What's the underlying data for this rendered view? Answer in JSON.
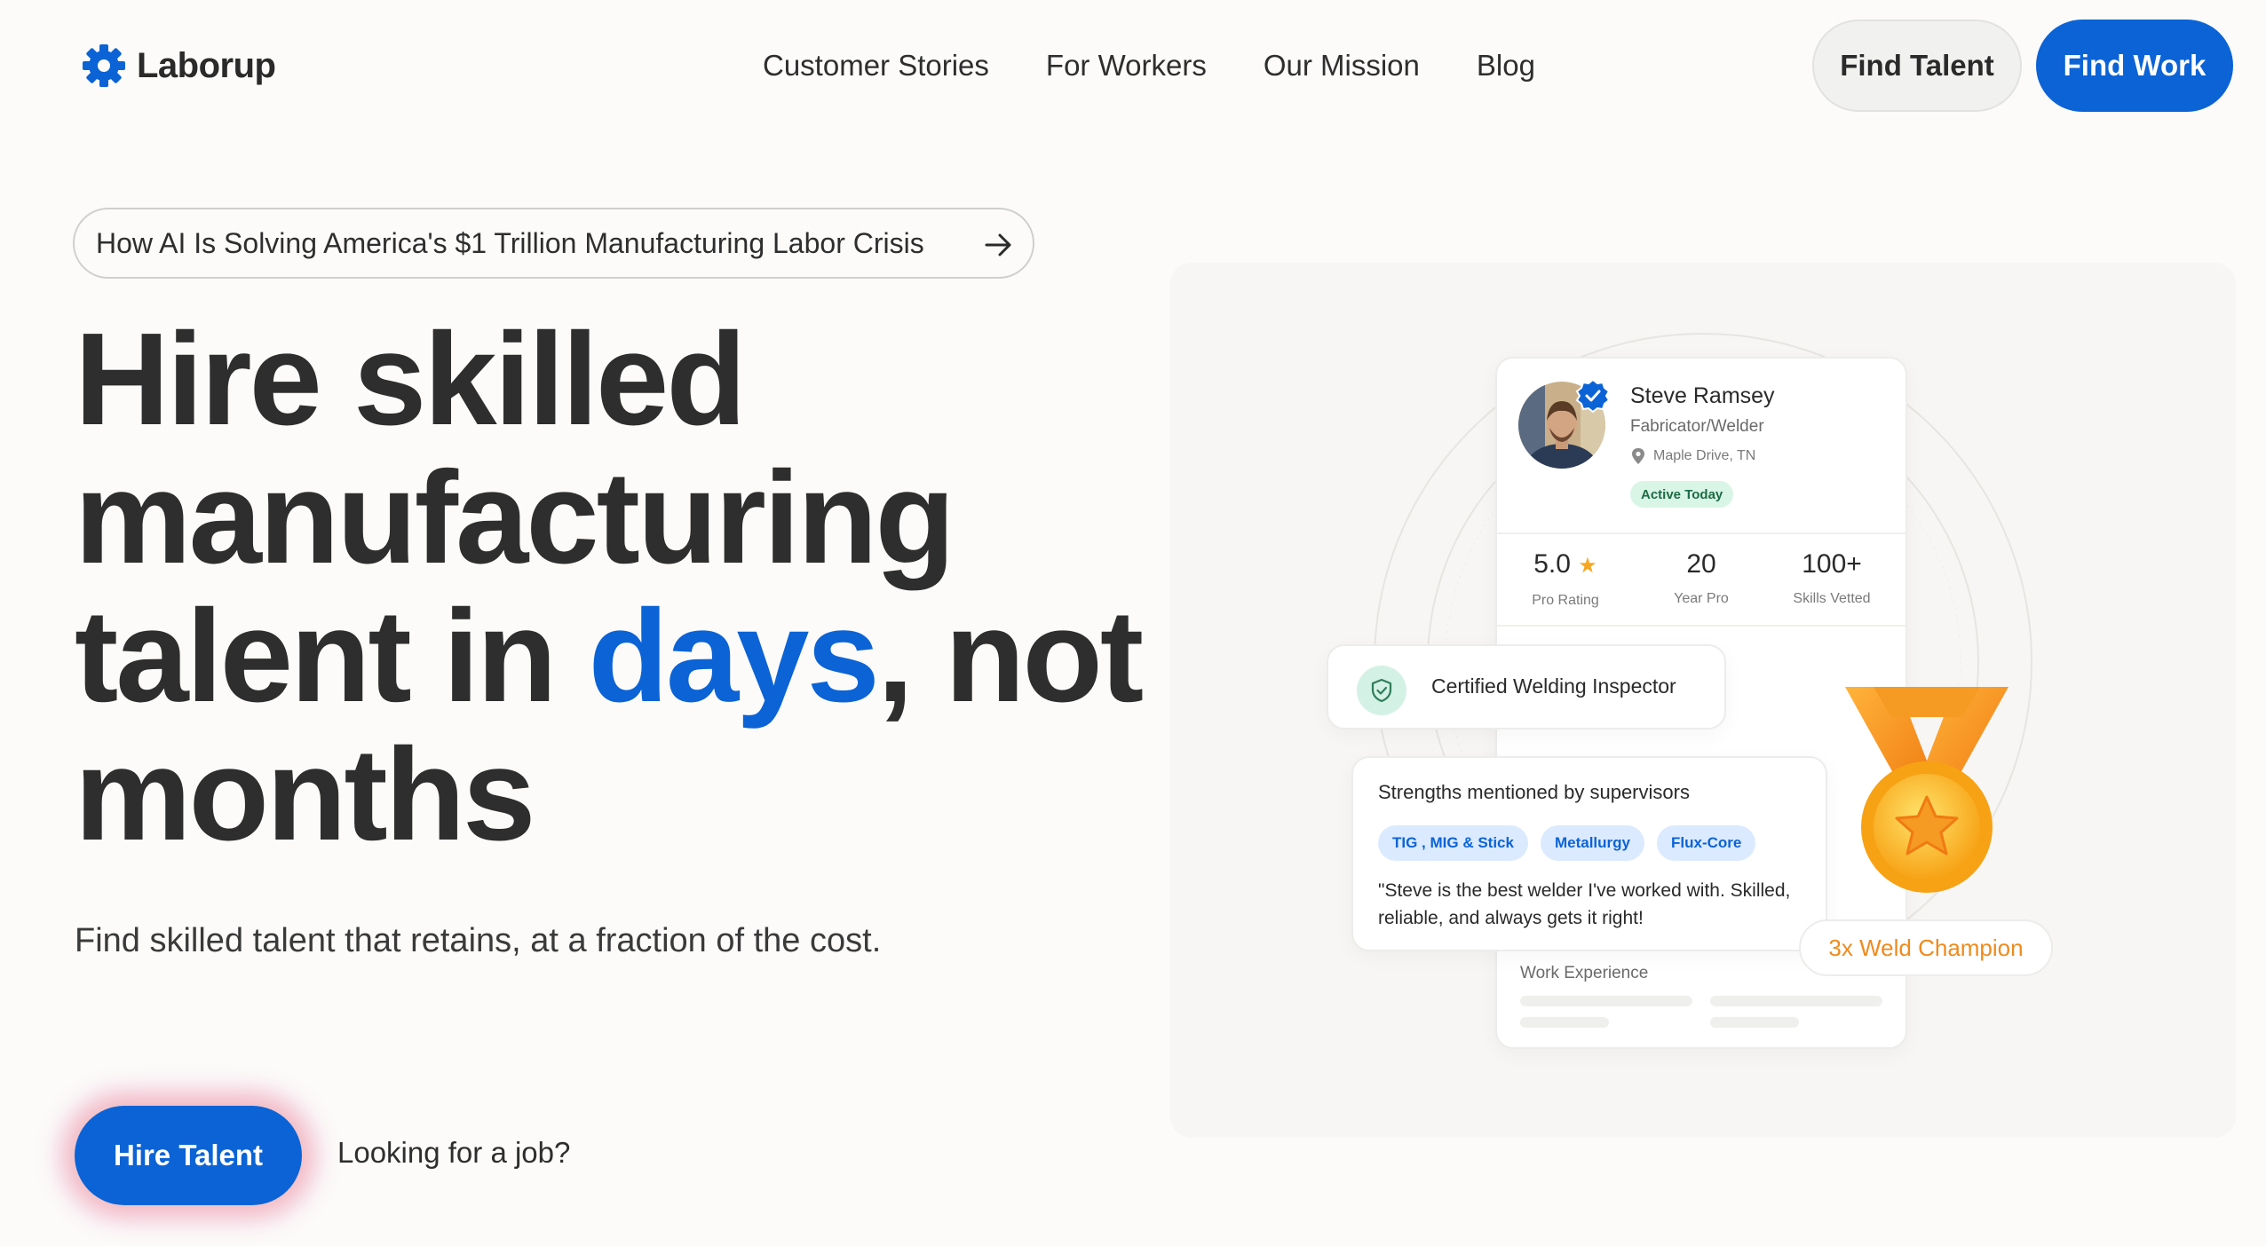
{
  "nav": {
    "logo_text": "Laborup",
    "links": [
      "Customer Stories",
      "For Workers",
      "Our Mission",
      "Blog"
    ],
    "find_talent": "Find Talent",
    "find_work": "Find Work"
  },
  "hero": {
    "announcement": "How AI Is Solving America's $1 Trillion Manufacturing Labor Crisis",
    "headline_1": "Hire skilled",
    "headline_2": "manufacturing",
    "headline_3a": "talent in ",
    "headline_accent": "days",
    "headline_3b": ", not",
    "headline_4": "months",
    "subhead": "Find skilled talent that retains, at a fraction of the cost.",
    "cta_primary": "Hire Talent",
    "cta_secondary": "Looking for a job?"
  },
  "profile": {
    "name": "Steve Ramsey",
    "role": "Fabricator/Welder",
    "location": "Maple Drive, TN",
    "status": "Active Today",
    "stats": [
      {
        "value": "5.0",
        "star": "★",
        "label": "Pro Rating"
      },
      {
        "value": "20",
        "label": "Year Pro"
      },
      {
        "value": "100+",
        "label": "Skills Vetted"
      }
    ],
    "certification": "Certified Welding Inspector",
    "strengths_title": "Strengths mentioned by supervisors",
    "chips": [
      "TIG , MIG & Stick",
      "Metallurgy",
      "Flux-Core"
    ],
    "quote": "\"Steve is the best welder I've worked with. Skilled, reliable, and always gets it right!",
    "work_experience": "Work Experience",
    "badge": "3x Weld Champion"
  },
  "colors": {
    "accent": "#0b63d6",
    "background": "#fcfbf9",
    "text": "#2e2e2e",
    "champion": "#f08a1c"
  },
  "icons": [
    "gear-logo-icon",
    "arrow-right-icon",
    "verified-check-icon",
    "location-pin-icon",
    "star-icon",
    "shield-check-icon",
    "medal-icon"
  ]
}
